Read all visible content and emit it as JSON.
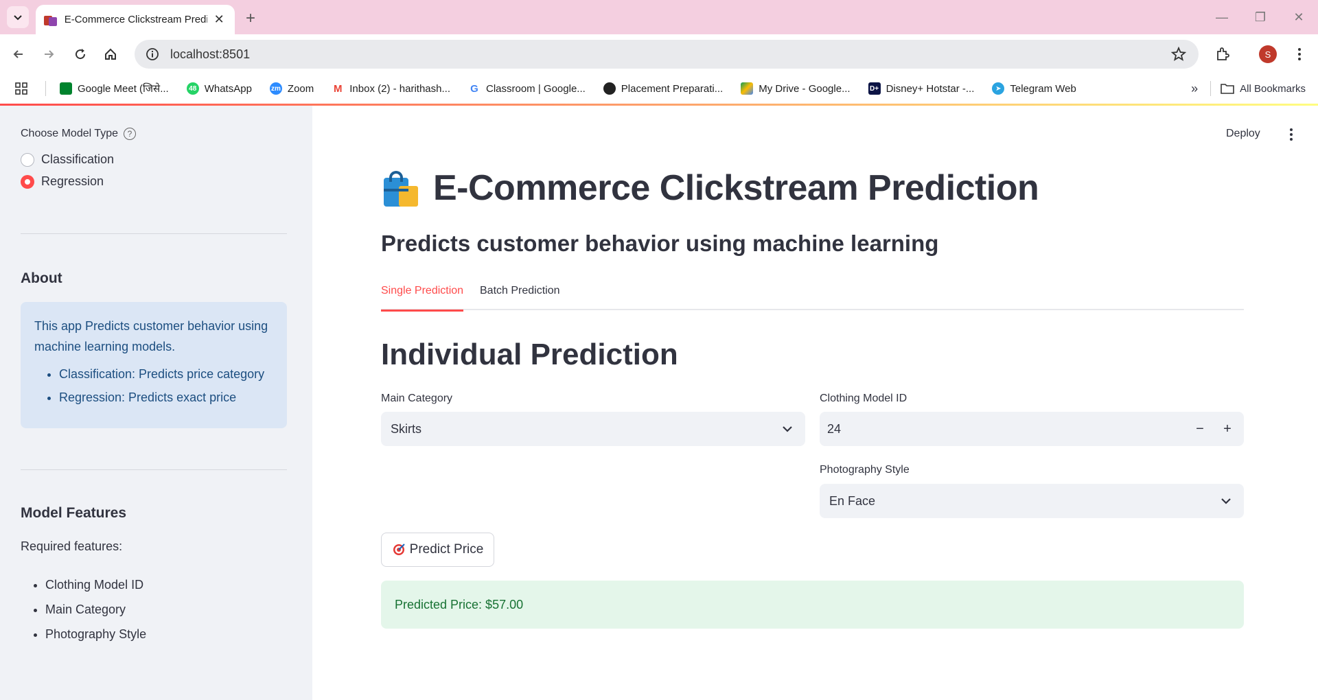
{
  "browser": {
    "tab_title": "E-Commerce Clickstream Predic",
    "url": "localhost:8501",
    "profile_initial": "S",
    "bookmarks": [
      {
        "label": "Google Meet (जिसे...",
        "icon": "google-meet-icon",
        "color": "#00832d"
      },
      {
        "label": "WhatsApp",
        "icon": "whatsapp-icon",
        "color": "#25d366",
        "badge": "48"
      },
      {
        "label": "Zoom",
        "icon": "zoom-icon",
        "color": "#2d8cff"
      },
      {
        "label": "Inbox (2) - harithash...",
        "icon": "gmail-icon",
        "color": "#ea4335"
      },
      {
        "label": "Classroom | Google...",
        "icon": "google-icon",
        "color": "#4285f4"
      },
      {
        "label": "Placement Preparati...",
        "icon": "globe-icon",
        "color": "#222222"
      },
      {
        "label": "My Drive - Google...",
        "icon": "google-drive-icon",
        "color": "#fbbc04"
      },
      {
        "label": "Disney+ Hotstar -...",
        "icon": "hotstar-icon",
        "color": "#0c1445"
      },
      {
        "label": "Telegram Web",
        "icon": "telegram-icon",
        "color": "#2aa3e0"
      }
    ],
    "all_bookmarks": "All Bookmarks"
  },
  "sidebar": {
    "model_type_label": "Choose Model Type",
    "options": [
      "Classification",
      "Regression"
    ],
    "selected": "Regression",
    "about_heading": "About",
    "about_text": "This app Predicts customer behavior using machine learning models.",
    "about_items": [
      "Classification: Predicts price category",
      "Regression: Predicts exact price"
    ],
    "features_heading": "Model Features",
    "features_intro": "Required features:",
    "features": [
      "Clothing Model ID",
      "Main Category",
      "Photography Style"
    ]
  },
  "main": {
    "deploy": "Deploy",
    "title": "E-Commerce Clickstream Prediction",
    "subtitle": "Predicts customer behavior using machine learning",
    "tabs": [
      "Single Prediction",
      "Batch Prediction"
    ],
    "section_title": "Individual Prediction",
    "main_category_label": "Main Category",
    "main_category_value": "Skirts",
    "model_id_label": "Clothing Model ID",
    "model_id_value": "24",
    "photo_style_label": "Photography Style",
    "photo_style_value": "En Face",
    "predict_button": "Predict Price",
    "result": "Predicted Price: $57.00"
  },
  "colors": {
    "accent": "#ff4b4b",
    "sidebar_bg": "#f0f2f6",
    "info_bg": "#dbe6f5",
    "success_bg": "#e4f6ea",
    "success_text": "#177233"
  }
}
